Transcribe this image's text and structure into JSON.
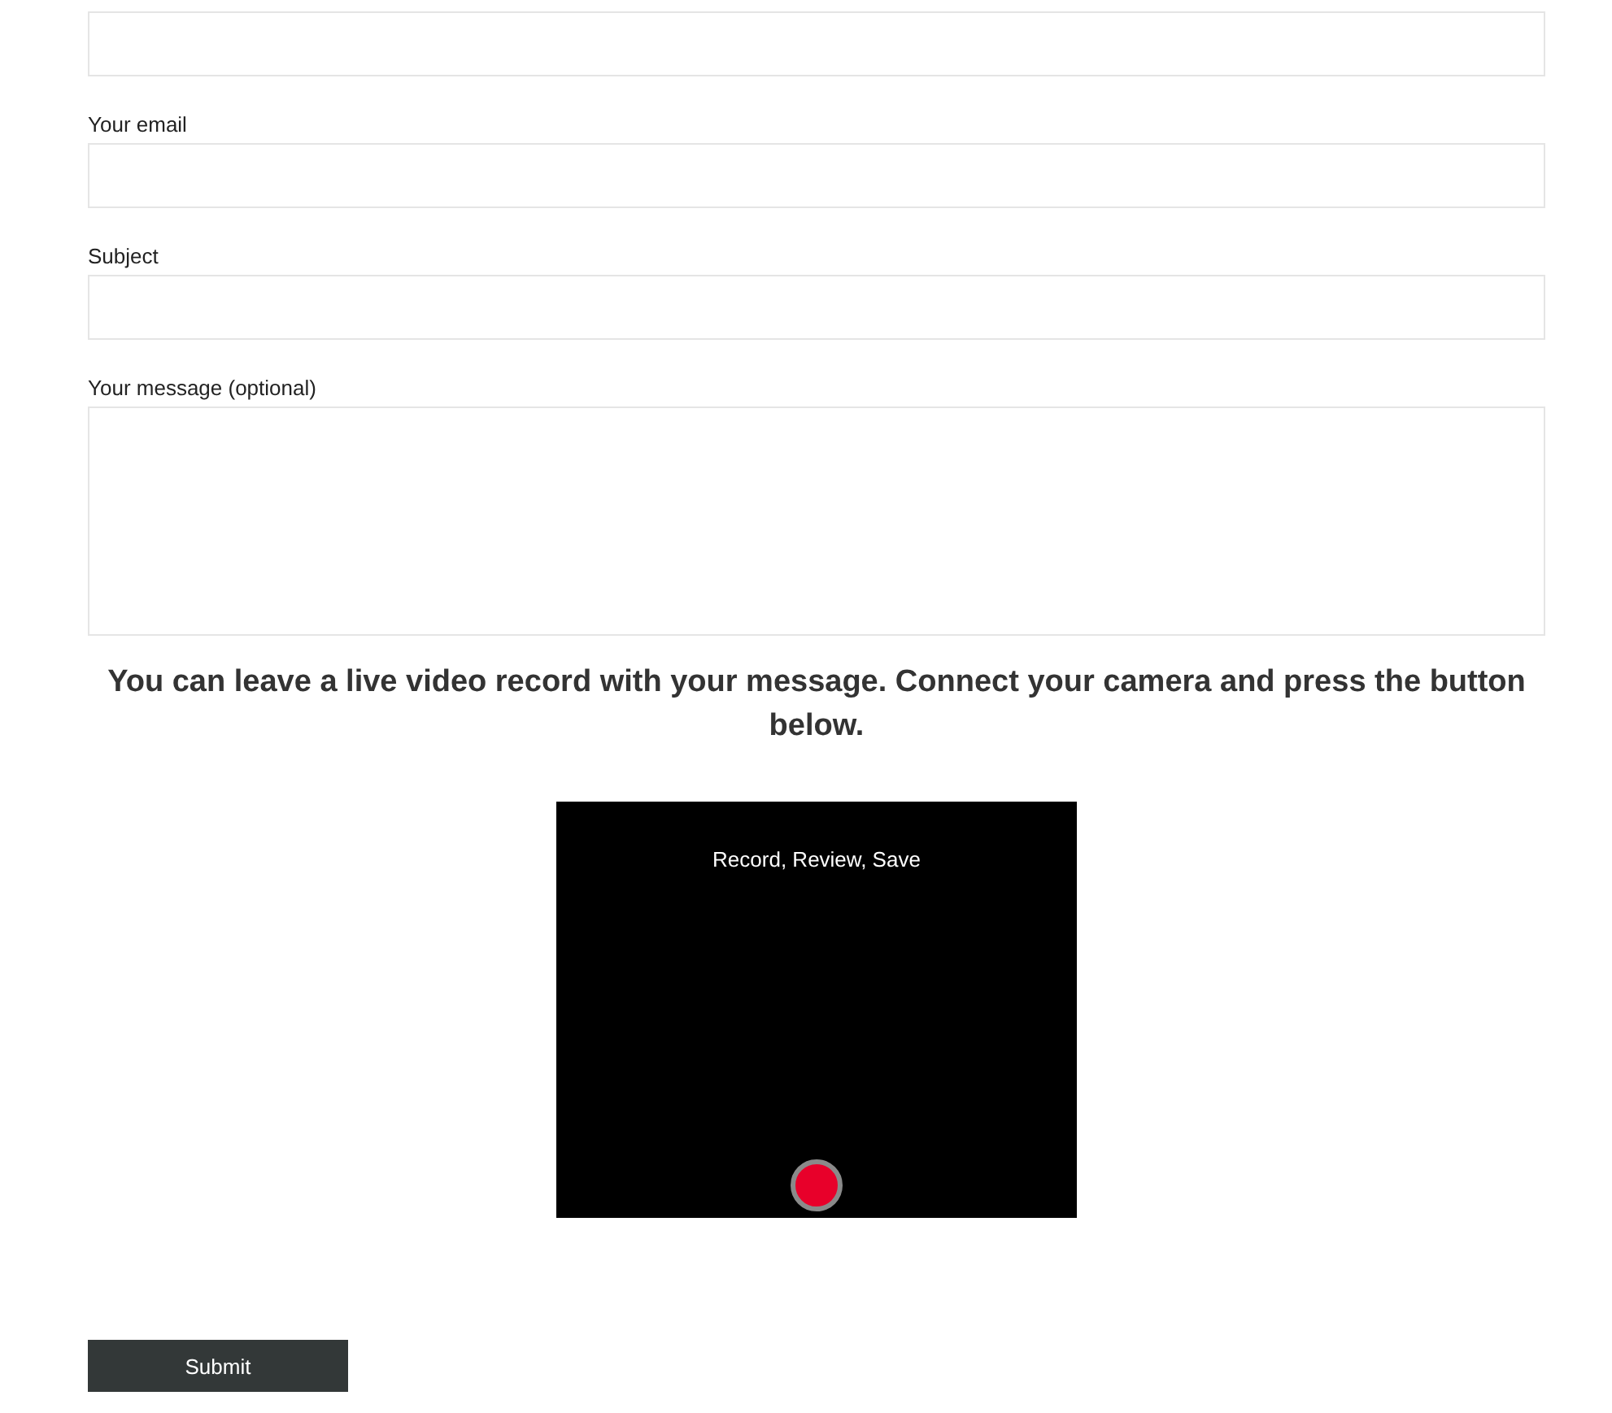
{
  "fields": [
    {
      "kind": "input"
    },
    {
      "kind": "input",
      "label": "Your email"
    },
    {
      "kind": "input",
      "label": "Subject"
    },
    {
      "kind": "textarea",
      "label": "Your message (optional)"
    }
  ],
  "video_prompt": "You can leave a live video record with your message. Connect your camera and press the button below.",
  "recorder": {
    "title": "Record, Review, Save"
  },
  "submit": "Submit"
}
